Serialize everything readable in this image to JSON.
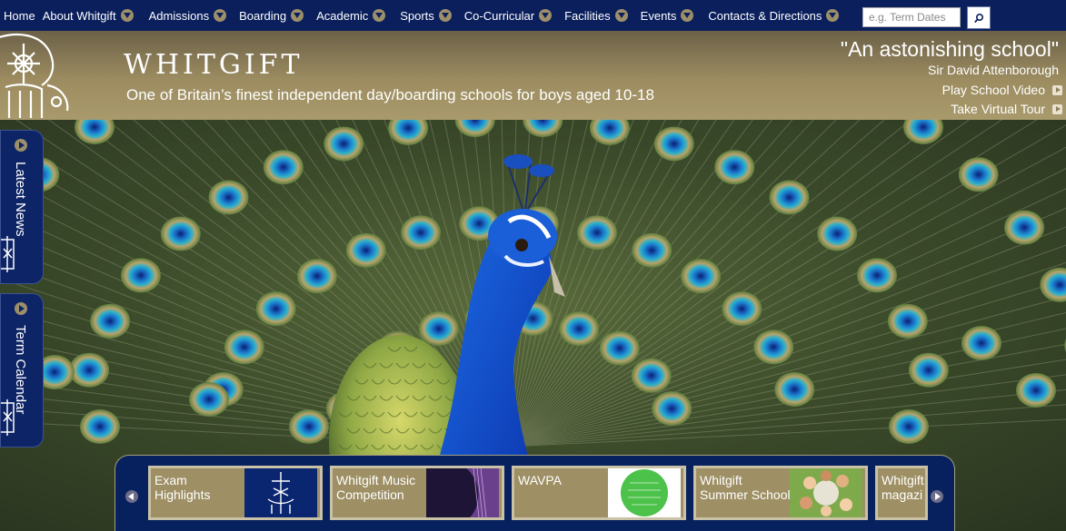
{
  "nav": {
    "items": [
      {
        "label": "Home",
        "has_menu": false
      },
      {
        "label": "About Whitgift",
        "has_menu": true
      },
      {
        "label": "Admissions",
        "has_menu": true
      },
      {
        "label": "Boarding",
        "has_menu": true
      },
      {
        "label": "Academic",
        "has_menu": true
      },
      {
        "label": "Sports",
        "has_menu": true
      },
      {
        "label": "Co-Curricular",
        "has_menu": true
      },
      {
        "label": "Facilities",
        "has_menu": true
      },
      {
        "label": "Events",
        "has_menu": true
      },
      {
        "label": "Contacts & Directions",
        "has_menu": true
      }
    ],
    "search_placeholder": "e.g. Term Dates",
    "search_value": ""
  },
  "header": {
    "wordmark": "WHITGIFT",
    "tagline": "One of Britain’s finest independent day/boarding schools for boys aged 10-18",
    "quote": "\"An astonishing school\"",
    "quote_author": "Sir David Attenborough",
    "links": [
      "Play School Video",
      "Take Virtual Tour"
    ]
  },
  "side_tabs": [
    "Latest News",
    "Term Calendar"
  ],
  "carousel": {
    "cards": [
      {
        "title": "Exam Highlights"
      },
      {
        "title": "Whitgift Music Competition"
      },
      {
        "title": "WAVPA"
      },
      {
        "title": "Whitgift Summer School"
      },
      {
        "title": "Whitgift magazi"
      }
    ]
  },
  "colors": {
    "nav_bg": "#0a1f5c",
    "gold": "#9c8c60",
    "navy": "#0d2466"
  }
}
